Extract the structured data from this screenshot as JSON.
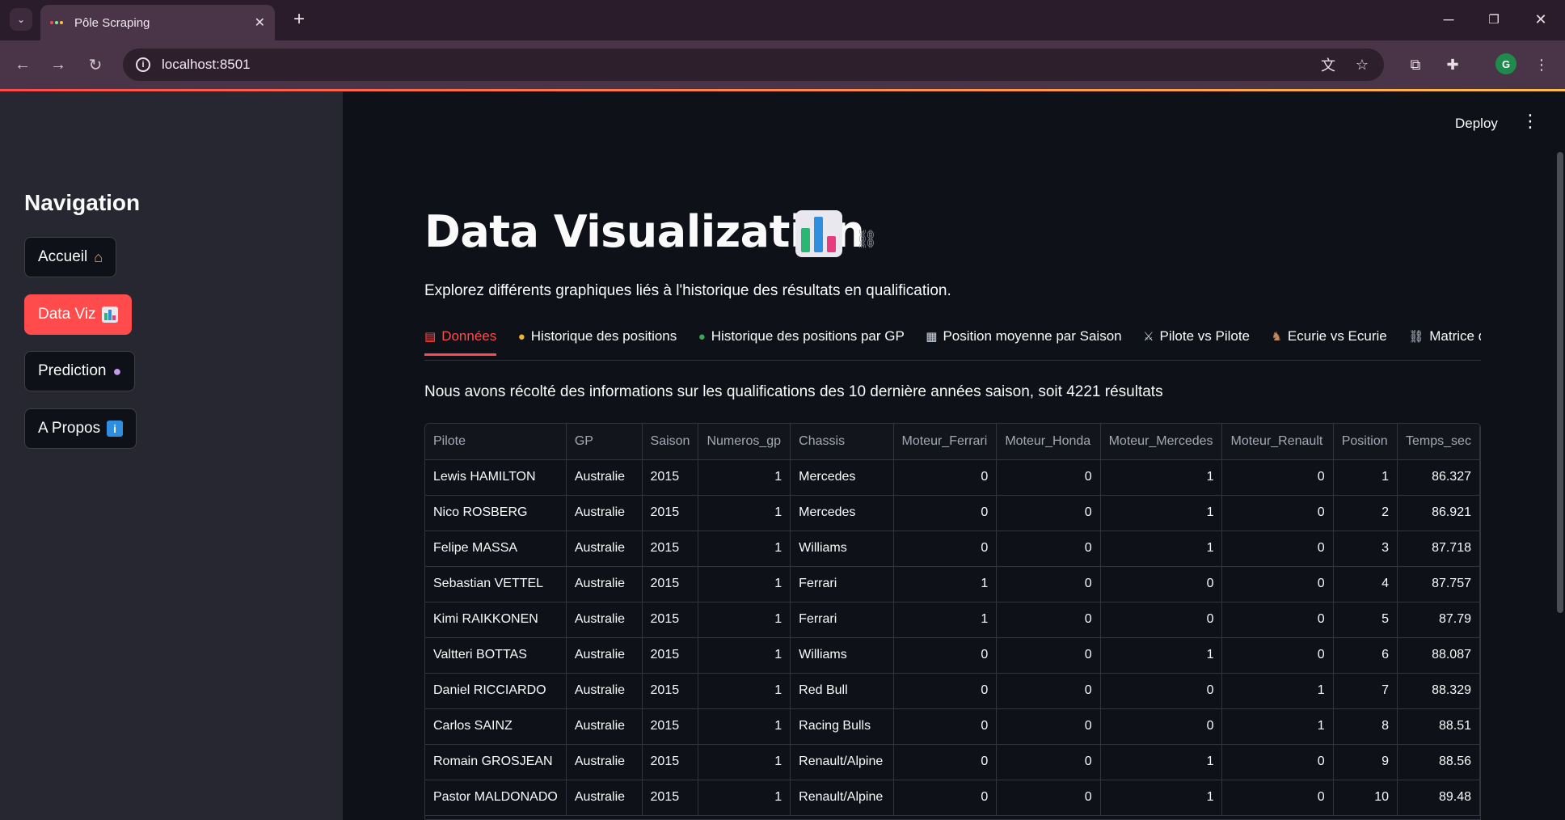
{
  "browser": {
    "tab_title": "Pôle Scraping",
    "url": "localhost:8501",
    "profile_initial": "G"
  },
  "sidebar": {
    "heading": "Navigation",
    "items": [
      {
        "label": "Accueil",
        "icon": "house-emoji",
        "active": false
      },
      {
        "label": "Data Viz",
        "icon": "bar-chart-emoji",
        "active": true
      },
      {
        "label": "Prediction",
        "icon": "crystal-ball-emoji",
        "active": false
      },
      {
        "label": "A Propos",
        "icon": "info-emoji",
        "active": false
      }
    ]
  },
  "header": {
    "deploy_label": "Deploy"
  },
  "main": {
    "title": "Data Visualization",
    "subtitle": "Explorez différents graphiques liés à l'historique des résultats en qualification.",
    "tabs": [
      {
        "label": "Données",
        "icon": "clipboard-icon",
        "active": true
      },
      {
        "label": "Historique des positions",
        "icon": "medal-icon",
        "active": false
      },
      {
        "label": "Historique des positions par GP",
        "icon": "globe-icon",
        "active": false
      },
      {
        "label": "Position moyenne par Saison",
        "icon": "calendar-icon",
        "active": false
      },
      {
        "label": "Pilote vs Pilote",
        "icon": "crossed-swords-icon",
        "active": false
      },
      {
        "label": "Ecurie vs Ecurie",
        "icon": "horse-icon",
        "active": false
      },
      {
        "label": "Matrice de",
        "icon": "link-icon",
        "active": false
      }
    ],
    "info_text": "Nous avons récolté des informations sur les qualifications des 10 dernière années saison, soit 4221 résultats"
  },
  "table": {
    "columns": [
      "Pilote",
      "GP",
      "Saison",
      "Numeros_gp",
      "Chassis",
      "Moteur_Ferrari",
      "Moteur_Honda",
      "Moteur_Mercedes",
      "Moteur_Renault",
      "Position",
      "Temps_sec"
    ],
    "rows": [
      [
        "Lewis HAMILTON",
        "Australie",
        "2015",
        "1",
        "Mercedes",
        "0",
        "0",
        "1",
        "0",
        "1",
        "86.327"
      ],
      [
        "Nico ROSBERG",
        "Australie",
        "2015",
        "1",
        "Mercedes",
        "0",
        "0",
        "1",
        "0",
        "2",
        "86.921"
      ],
      [
        "Felipe MASSA",
        "Australie",
        "2015",
        "1",
        "Williams",
        "0",
        "0",
        "1",
        "0",
        "3",
        "87.718"
      ],
      [
        "Sebastian VETTEL",
        "Australie",
        "2015",
        "1",
        "Ferrari",
        "1",
        "0",
        "0",
        "0",
        "4",
        "87.757"
      ],
      [
        "Kimi RAIKKONEN",
        "Australie",
        "2015",
        "1",
        "Ferrari",
        "1",
        "0",
        "0",
        "0",
        "5",
        "87.79"
      ],
      [
        "Valtteri BOTTAS",
        "Australie",
        "2015",
        "1",
        "Williams",
        "0",
        "0",
        "1",
        "0",
        "6",
        "88.087"
      ],
      [
        "Daniel RICCIARDO",
        "Australie",
        "2015",
        "1",
        "Red Bull",
        "0",
        "0",
        "0",
        "1",
        "7",
        "88.329"
      ],
      [
        "Carlos SAINZ",
        "Australie",
        "2015",
        "1",
        "Racing Bulls",
        "0",
        "0",
        "0",
        "1",
        "8",
        "88.51"
      ],
      [
        "Romain GROSJEAN",
        "Australie",
        "2015",
        "1",
        "Renault/Alpine",
        "0",
        "0",
        "1",
        "0",
        "9",
        "88.56"
      ],
      [
        "Pastor MALDONADO",
        "Australie",
        "2015",
        "1",
        "Renault/Alpine",
        "0",
        "0",
        "1",
        "0",
        "10",
        "89.48"
      ]
    ]
  }
}
